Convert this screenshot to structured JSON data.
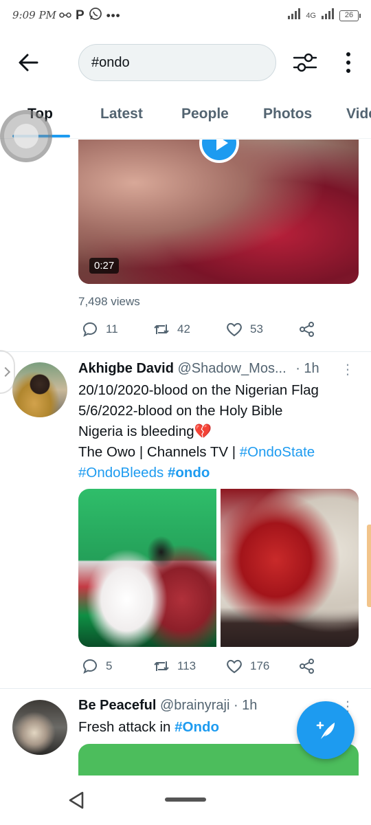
{
  "status_bar": {
    "time": "9:09 PM",
    "left_icons": [
      "headset-icon",
      "p-icon",
      "whatsapp-icon",
      "more-dots-icon"
    ],
    "network": "4G",
    "battery": "26"
  },
  "header": {
    "search_value": "#ondo",
    "icons": [
      "back-arrow-icon",
      "filter-icon",
      "more-vert-icon"
    ]
  },
  "tabs": [
    {
      "label": "Top",
      "active": true
    },
    {
      "label": "Latest",
      "active": false
    },
    {
      "label": "People",
      "active": false
    },
    {
      "label": "Photos",
      "active": false
    },
    {
      "label": "Videos",
      "active": false
    }
  ],
  "colors": {
    "accent": "#1d9bf0",
    "text": "#0f1419",
    "muted": "#536471"
  },
  "tweets": [
    {
      "video_duration": "0:27",
      "views": "7,498 views",
      "replies": "11",
      "retweets": "42",
      "likes": "53"
    },
    {
      "name": "Akhigbe David",
      "handle": "@Shadow_Mos...",
      "time": "· 1h",
      "text_line1": "20/10/2020-blood on the Nigerian Flag",
      "text_line2": "5/6/2022-blood on the Holy Bible",
      "text_line3": "Nigeria is bleeding💔",
      "text_line4_prefix": "The Owo | Channels TV | ",
      "hashtag1": "#OndoState",
      "hashtag2": "#OndoBleeds",
      "hashtag3": "#ondo",
      "replies": "5",
      "retweets": "113",
      "likes": "176"
    },
    {
      "name": "Be Peaceful",
      "handle": "@brainyraji",
      "time": "· 1h",
      "text_prefix": "Fresh attack in ",
      "hashtag": "#Ondo"
    }
  ]
}
